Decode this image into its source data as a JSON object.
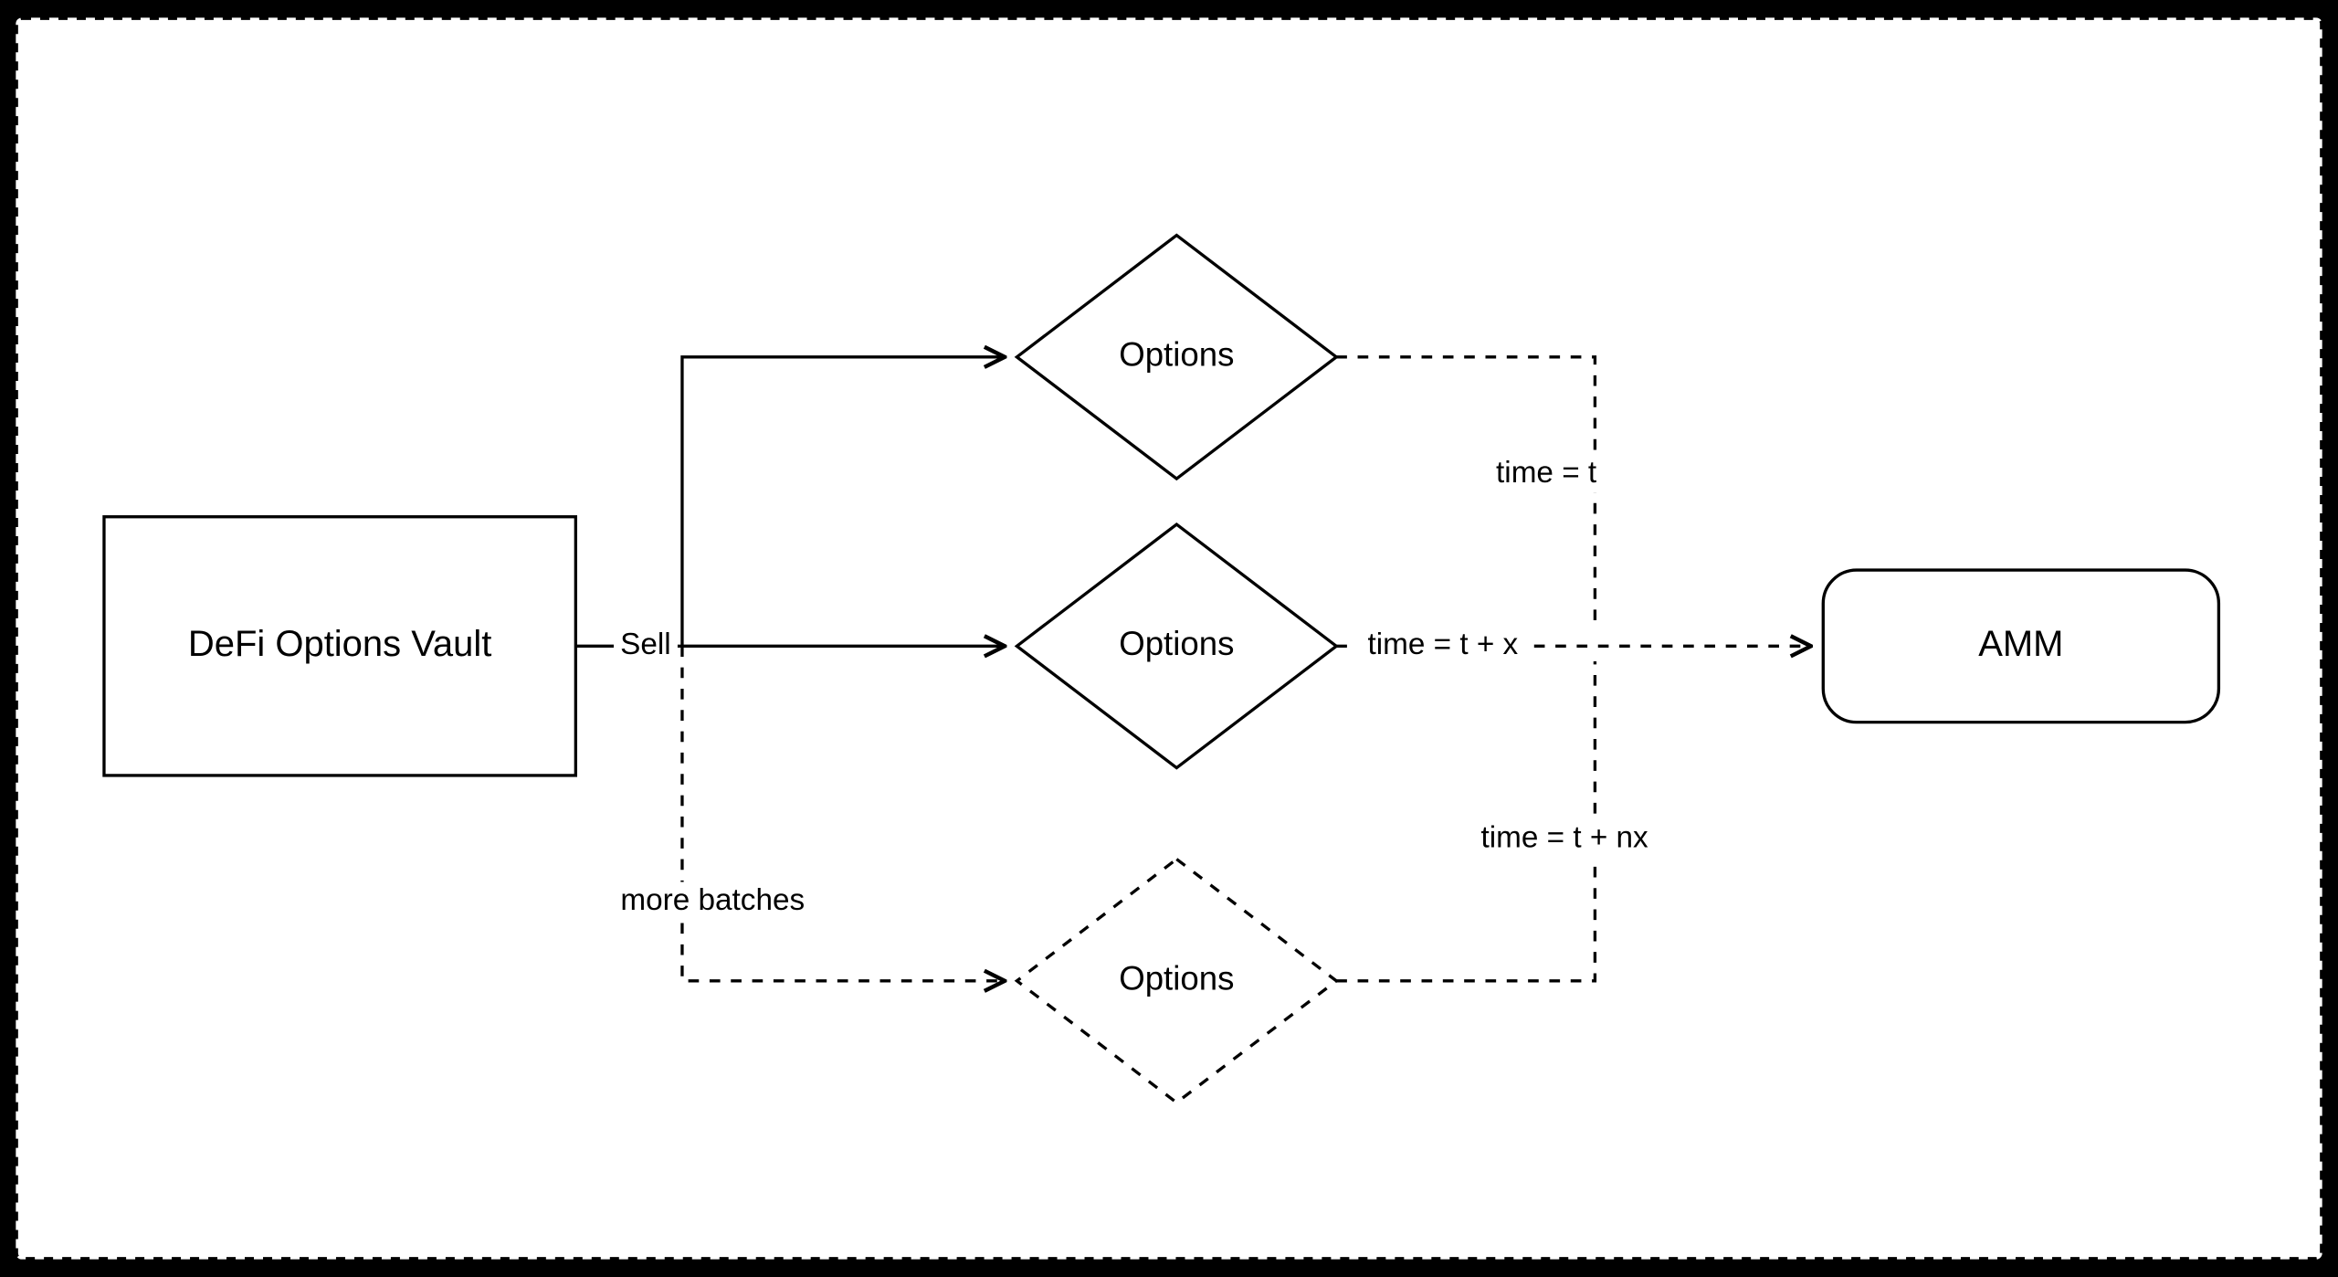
{
  "nodes": {
    "vault": "DeFi Options Vault",
    "options1": "Options",
    "options2": "Options",
    "options3": "Options",
    "amm": "AMM"
  },
  "edges": {
    "sell": "Sell",
    "more_batches": "more batches",
    "time_t": "time = t",
    "time_tx": "time = t + x",
    "time_tnx": "time = t + nx"
  }
}
